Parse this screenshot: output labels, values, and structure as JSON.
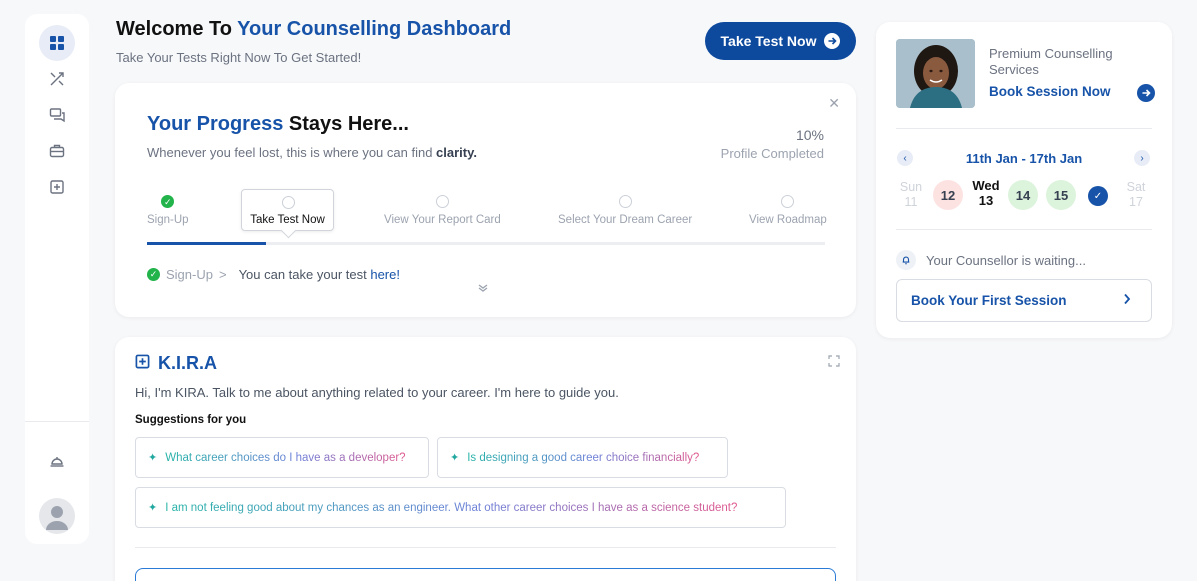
{
  "header": {
    "title_plain": "Welcome To ",
    "title_accent": "Your Counselling Dashboard",
    "subtitle": "Take Your Tests Right Now To Get Started!",
    "cta_label": "Take Test Now"
  },
  "sidebar": {
    "items": [
      {
        "icon": "dashboard-icon",
        "active": true
      },
      {
        "icon": "tools-icon"
      },
      {
        "icon": "chat-icon"
      },
      {
        "icon": "briefcase-icon"
      },
      {
        "icon": "add-box-icon"
      }
    ],
    "bottom_icon": "desk-bell-icon"
  },
  "progress": {
    "title_accent": "Your Progress",
    "title_plain": " Stays Here...",
    "subtitle_plain": "Whenever you feel lost, this is where you can find ",
    "subtitle_bold": "clarity.",
    "percent": "10%",
    "percent_label": "Profile Completed",
    "progress_fraction": 0.175,
    "steps": [
      {
        "label": "Sign-Up",
        "done": true
      },
      {
        "label": "Take Test Now",
        "current": true
      },
      {
        "label": "View Your Report Card"
      },
      {
        "label": "Select Your Dream Career"
      },
      {
        "label": "View Roadmap"
      }
    ],
    "crumb_done": "Sign-Up",
    "crumb_sep": ">",
    "crumb_message": "You can take your test ",
    "crumb_link": "here!"
  },
  "kira": {
    "title": "K.I.R.A",
    "description": "Hi, I'm KIRA. Talk to me about anything related to your career. I'm here to guide you.",
    "suggestions_label": "Suggestions for you",
    "suggestions": [
      "What career choices do I have as a developer?",
      "Is designing a good career choice financially?",
      "I am not feeling good about my chances as an engineer. What other career choices I have as a science student?"
    ]
  },
  "right_panel": {
    "promo_label": "Premium Counselling Services",
    "promo_link": "Book Session Now",
    "week_range": "11th Jan - 17th Jan",
    "days": [
      {
        "name": "Sun",
        "date": "11"
      },
      {
        "date": "12",
        "status": "red"
      },
      {
        "name": "Wed",
        "date": "13",
        "today": true
      },
      {
        "date": "14",
        "status": "green"
      },
      {
        "date": "15",
        "status": "green"
      },
      {
        "status": "booked"
      },
      {
        "name": "Sat",
        "date": "17"
      }
    ],
    "waiting_text": "Your Counsellor is waiting...",
    "book_first_label": "Book Your First Session"
  },
  "colors": {
    "accent": "#1753a8",
    "primary_button": "#0d4a9e",
    "success": "#22b34a"
  }
}
